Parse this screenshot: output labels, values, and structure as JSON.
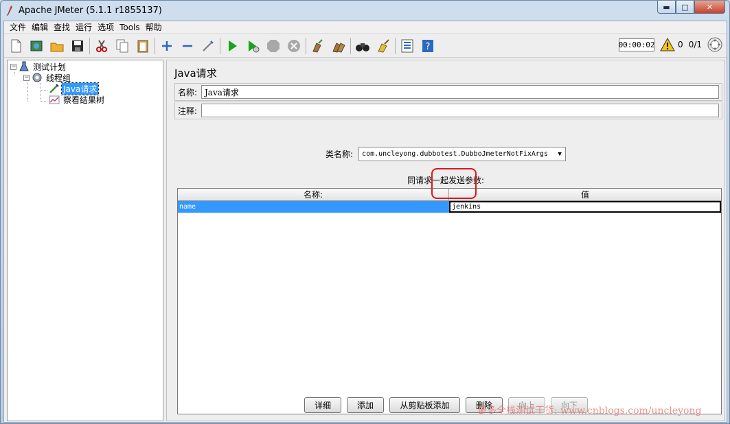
{
  "window": {
    "title": "Apache JMeter (5.1.1 r1855137)"
  },
  "menu": [
    "文件",
    "编辑",
    "查找",
    "运行",
    "选项",
    "Tools",
    "帮助"
  ],
  "toolbar": {
    "timer": "00:00:02",
    "warning_count": "0",
    "thread_count": "0/1"
  },
  "tree": {
    "nodes": [
      {
        "label": "测试计划",
        "icon": "test-plan-icon"
      },
      {
        "label": "线程组",
        "icon": "gear-icon"
      },
      {
        "label": "Java请求",
        "icon": "pipette-icon"
      },
      {
        "label": "察看结果树",
        "icon": "chart-icon"
      }
    ]
  },
  "panel": {
    "title": "Java请求",
    "name_label": "名称:",
    "name_value": "Java请求",
    "comment_label": "注释:",
    "comment_value": "",
    "classname_label": "类名称:",
    "classname_value": "com.uncleyong.dubbotest.DubboJmeterNotFixArgs",
    "params_title": "同请求一起发送参数:",
    "table": {
      "headers": [
        "名称:",
        "值"
      ],
      "rows": [
        {
          "name": "name",
          "value": "jenkins"
        }
      ]
    },
    "buttons": {
      "detail": "详细",
      "add": "添加",
      "add_clipboard": "从剪贴板添加",
      "delete": "删除",
      "up": "向上",
      "down": "向下"
    }
  },
  "watermark": "更多全栈测试干货: www.cnblogs.com/uncleyong",
  "colors": {
    "selection": "#3399ff",
    "highlight": "#e0141e"
  }
}
